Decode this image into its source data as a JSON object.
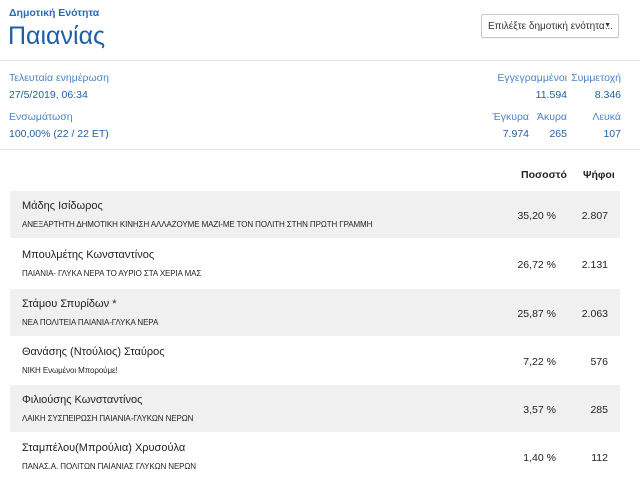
{
  "header": {
    "subtitle": "Δημοτική Ενότητα",
    "title": "Παιανίας",
    "select_value": "Επιλέξτε δημοτική ενότητα..."
  },
  "stats": {
    "last_update_label": "Τελευταία ενημέρωση",
    "last_update_value": "27/5/2019, 06:34",
    "registered_label": "Εγγεγραμμένοι",
    "registered_value": "11.594",
    "turnout_label": "Συμμετοχή",
    "turnout_value": "8.346",
    "integration_label": "Ενσωμάτωση",
    "integration_value": "100,00% (22 / 22 ΕΤ)",
    "valid_label": "Έγκυρα",
    "valid_value": "7.974",
    "invalid_label": "Άκυρα",
    "invalid_value": "265",
    "blank_label": "Λευκά",
    "blank_value": "107"
  },
  "table": {
    "col_percent": "Ποσοστό",
    "col_votes": "Ψήφοι",
    "rows": [
      {
        "name": "Μάδης Ισίδωρος",
        "party": "ΑΝΕΞΑΡΤΗΤΗ ΔΗΜΟΤΙΚΗ ΚΙΝΗΣΗ ΑΛΛΑΖΟΥΜΕ ΜΑΖΙ-ΜΕ ΤΟΝ ΠΟΛΙΤΗ ΣΤΗΝ ΠΡΩΤΗ ΓΡΑΜΜΗ",
        "percent": "35,20 %",
        "votes": "2.807"
      },
      {
        "name": "Μπουλμέτης Κωνσταντίνος",
        "party": "ΠΑΙΑΝΙΑ- ΓΛΥΚΑ ΝΕΡΑ ΤΟ ΑΥΡΙΟ ΣΤΑ ΧΕΡΙΑ ΜΑΣ",
        "percent": "26,72 %",
        "votes": "2.131"
      },
      {
        "name": "Στάμου Σπυρίδων *",
        "party": "ΝΕΑ ΠΟΛΙΤΕΙΑ ΠΑΙΑΝΙΑ-ΓΛΥΚΑ ΝΕΡΑ",
        "percent": "25,87 %",
        "votes": "2.063"
      },
      {
        "name": "Θανάσης (Ντούλιος) Σταύρος",
        "party": "ΝΙΚΗ Ενωμένοι Μπορούμε!",
        "percent": "7,22 %",
        "votes": "576"
      },
      {
        "name": "Φιλιούσης Κωνσταντίνος",
        "party": "ΛΑΙΚΗ ΣΥΣΠΕΙΡΩΣΗ ΠΑΙΑΝΙΑ-ΓΛΥΚΩΝ ΝΕΡΩΝ",
        "percent": "3,57 %",
        "votes": "285"
      },
      {
        "name": "Σταμπέλου(Μπρούλια) Χρυσούλα",
        "party": "ΠΑΝΑΣ.Α. ΠΟΛΙΤΩΝ ΠΑΙΑΝΙΑΣ ΓΛΥΚΩΝ ΝΕΡΩΝ",
        "percent": "1,40 %",
        "votes": "112"
      }
    ]
  }
}
